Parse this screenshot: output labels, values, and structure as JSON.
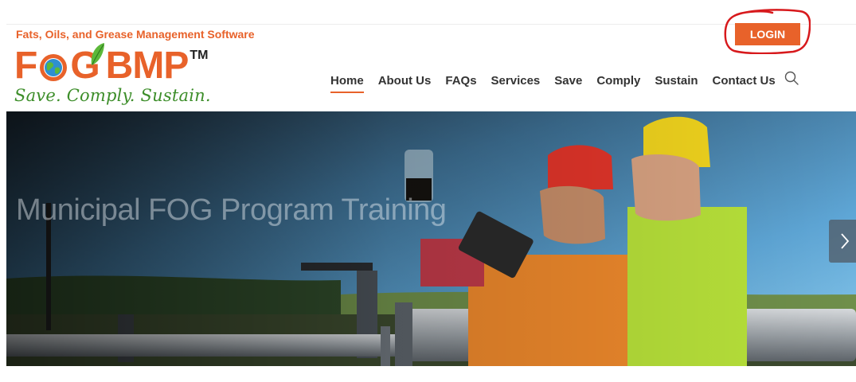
{
  "header": {
    "tagline": "Fats, Oils, and Grease Management Software",
    "login_label": "LOGIN",
    "logo": {
      "letters_left": "F",
      "letters_mid": "G",
      "letters_right": "BMP",
      "trademark": "TM",
      "slogan": "Save. Comply. Sustain."
    }
  },
  "nav": {
    "items": [
      {
        "label": "Home",
        "active": true
      },
      {
        "label": "About Us"
      },
      {
        "label": "FAQs"
      },
      {
        "label": "Services"
      },
      {
        "label": "Save"
      },
      {
        "label": "Comply"
      },
      {
        "label": "Sustain"
      },
      {
        "label": "Contact Us"
      }
    ],
    "search_icon": "search-icon"
  },
  "hero": {
    "title": "Municipal FOG Program Training",
    "next_icon": "chevron-right-icon"
  },
  "colors": {
    "brand_orange": "#e8622a",
    "brand_green": "#3d8e2a",
    "annotation_red": "#d7191c"
  }
}
